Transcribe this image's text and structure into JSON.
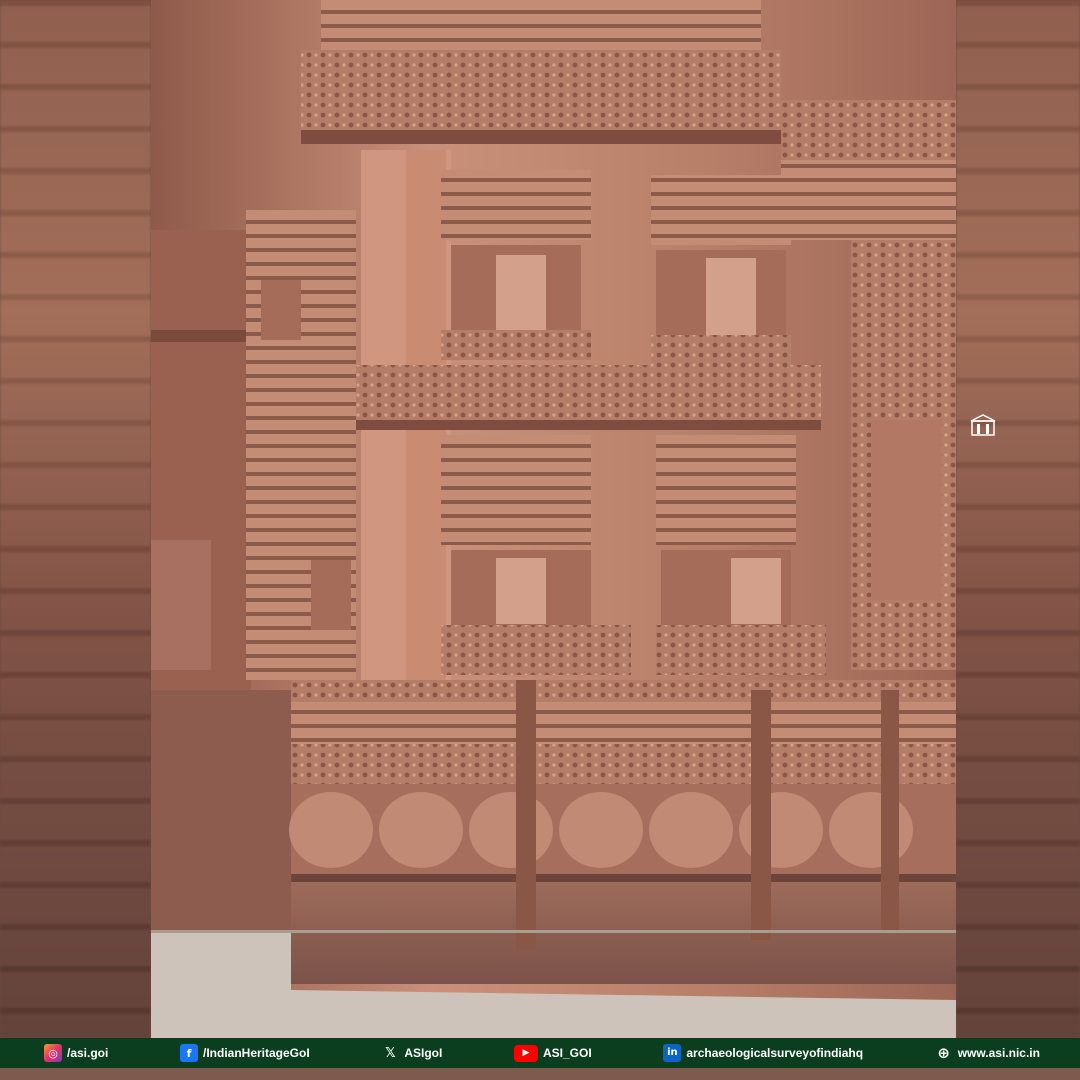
{
  "image": {
    "subject": "carved-sandstone-temple-wall",
    "emblem_icon": "asi-emblem-icon"
  },
  "footer": {
    "instagram": {
      "icon": "instagram-icon",
      "label": "/asi.goi"
    },
    "facebook": {
      "icon": "facebook-icon",
      "label": "/IndianHeritageGoI"
    },
    "x": {
      "icon": "x-icon",
      "label": "ASIgoI"
    },
    "youtube": {
      "icon": "youtube-icon",
      "label": "ASI_GOI"
    },
    "linkedin": {
      "icon": "linkedin-icon",
      "label": "archaeologicalsurveyofindiahq"
    },
    "website": {
      "icon": "globe-icon",
      "label": "www.asi.nic.in"
    }
  },
  "colors": {
    "footer_bg": "#0b3d1f",
    "stone": "#b37a62",
    "stone_light": "#d49a82",
    "stone_dark": "#7d4a3c"
  }
}
